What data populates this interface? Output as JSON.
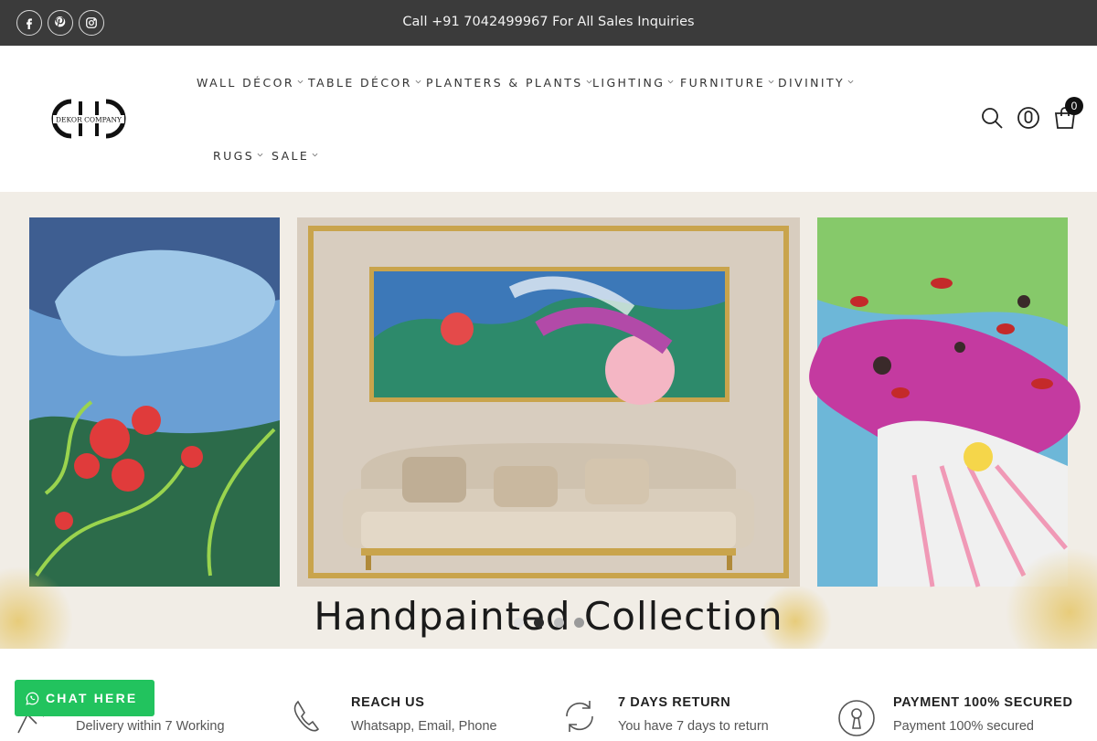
{
  "topbar": {
    "message": "Call +91 7042499967 For All Sales Inquiries",
    "social": [
      "facebook-icon",
      "pinterest-icon",
      "instagram-icon"
    ]
  },
  "brand": {
    "logo_text": "DEKOR COMPANY"
  },
  "nav": {
    "items": [
      {
        "label": "WALL DÉCOR"
      },
      {
        "label": "TABLE DÉCOR"
      },
      {
        "label": "PLANTERS & PLANTS"
      },
      {
        "label": "LIGHTING"
      },
      {
        "label": "FURNITURE"
      },
      {
        "label": "DIVINITY"
      },
      {
        "label": "RUGS"
      },
      {
        "label": "SALE"
      }
    ]
  },
  "header_icons": {
    "search": "search-icon",
    "account": "user-icon",
    "cart": "cart-icon",
    "cart_count": "0"
  },
  "hero": {
    "title": "Handpainted Collection",
    "slides_total": 4,
    "active_slide": 2
  },
  "features": [
    {
      "title": "",
      "text": "Delivery within 7 Working",
      "icon": "delivery-icon"
    },
    {
      "title": "REACH US",
      "text": "Whatsapp, Email, Phone",
      "icon": "phone-icon"
    },
    {
      "title": "7 DAYS RETURN",
      "text": "You have 7 days to return",
      "icon": "return-icon"
    },
    {
      "title": "PAYMENT 100% SECURED",
      "text": "Payment 100% secured",
      "icon": "secure-payment-icon"
    }
  ],
  "chat": {
    "label": "CHAT HERE",
    "icon": "whatsapp-icon"
  },
  "colors": {
    "topbar": "#3b3b3b",
    "chat": "#22c35e",
    "accent_gold": "#c9a44c"
  }
}
